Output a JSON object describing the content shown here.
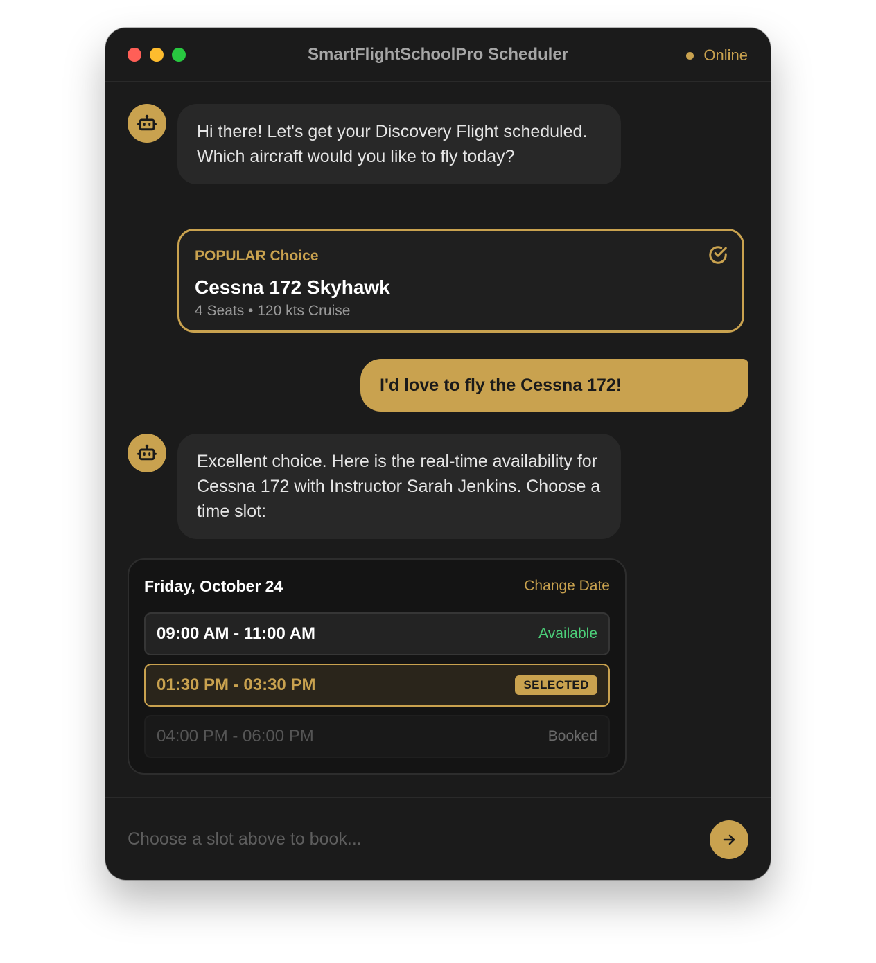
{
  "window": {
    "title": "SmartFlightSchoolPro Scheduler",
    "status": "Online"
  },
  "messages": {
    "bot_1": "Hi there! Let's get your Discovery Flight scheduled. Which aircraft would you like to fly today?",
    "aircraft_card": {
      "badge": "POPULAR Choice",
      "name": "Cessna 172 Skyhawk",
      "specs": "4 Seats • 120 kts Cruise",
      "icon": "check-circle-icon"
    },
    "user_1": "I'd love to fly the Cessna 172!",
    "bot_2": "Excellent choice. Here is the real-time availability for Cessna 172 with Instructor Sarah Jenkins. Choose a time slot:"
  },
  "schedule": {
    "date": "Friday, October 24",
    "change_date_label": "Change Date",
    "slots": [
      {
        "time": "09:00 AM - 11:00 AM",
        "status": "Available"
      },
      {
        "time": "01:30 PM - 03:30 PM",
        "status": "SELECTED"
      },
      {
        "time": "04:00 PM - 06:00 PM",
        "status": "Booked"
      }
    ]
  },
  "composer": {
    "placeholder": "Choose a slot above to book...",
    "send_icon": "arrow-right-icon"
  },
  "colors": {
    "accent": "#c9a24f",
    "background": "#1b1b1b",
    "available": "#4cd07a"
  }
}
